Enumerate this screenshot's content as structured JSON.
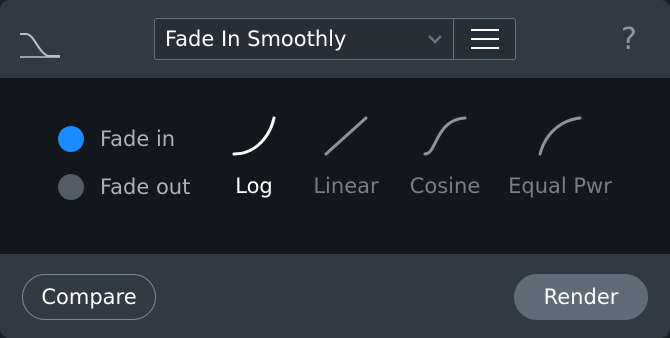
{
  "header": {
    "logo_icon": "fade-curve-icon",
    "preset_value": "Fade In Smoothly",
    "preset_chevron_icon": "chevron-down-icon",
    "preset_menu_icon": "hamburger-menu-icon",
    "help_label": "?"
  },
  "direction": {
    "options": [
      {
        "label": "Fade in",
        "selected": true
      },
      {
        "label": "Fade out",
        "selected": false
      }
    ]
  },
  "curves": {
    "selected": "Log",
    "options": [
      {
        "label": "Log",
        "icon": "log-curve-icon"
      },
      {
        "label": "Linear",
        "icon": "linear-curve-icon"
      },
      {
        "label": "Cosine",
        "icon": "cosine-curve-icon"
      },
      {
        "label": "Equal Pwr",
        "icon": "equal-power-curve-icon"
      }
    ]
  },
  "footer": {
    "compare_label": "Compare",
    "render_label": "Render"
  },
  "colors": {
    "accent": "#1a8cff",
    "panel": "#303a45",
    "main": "#12171c"
  }
}
